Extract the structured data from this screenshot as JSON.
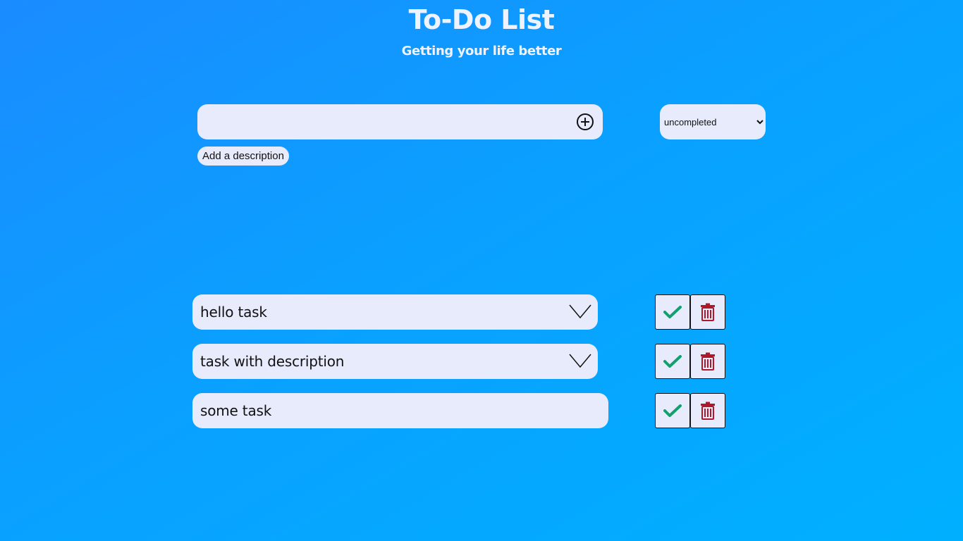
{
  "header": {
    "title": "To-Do List",
    "subtitle": "Getting your life better"
  },
  "add_form": {
    "input_value": "",
    "input_placeholder": "",
    "add_icon": "plus-circle-icon",
    "description_button_label": "Add a description"
  },
  "filter": {
    "selected": "uncompleted",
    "options": [
      "uncompleted"
    ]
  },
  "tasks": [
    {
      "label": "hello task",
      "expandable": true
    },
    {
      "label": "task with description",
      "expandable": true
    },
    {
      "label": "some task",
      "expandable": false
    }
  ],
  "colors": {
    "background_start": "#1a8cff",
    "background_end": "#00b0ff",
    "surface": "#e8ebfb",
    "complete_check": "#12a06e",
    "delete_trash": "#b0182a"
  },
  "icons": {
    "complete": "check-icon",
    "delete": "trash-icon",
    "expand": "chevron-down-icon"
  }
}
